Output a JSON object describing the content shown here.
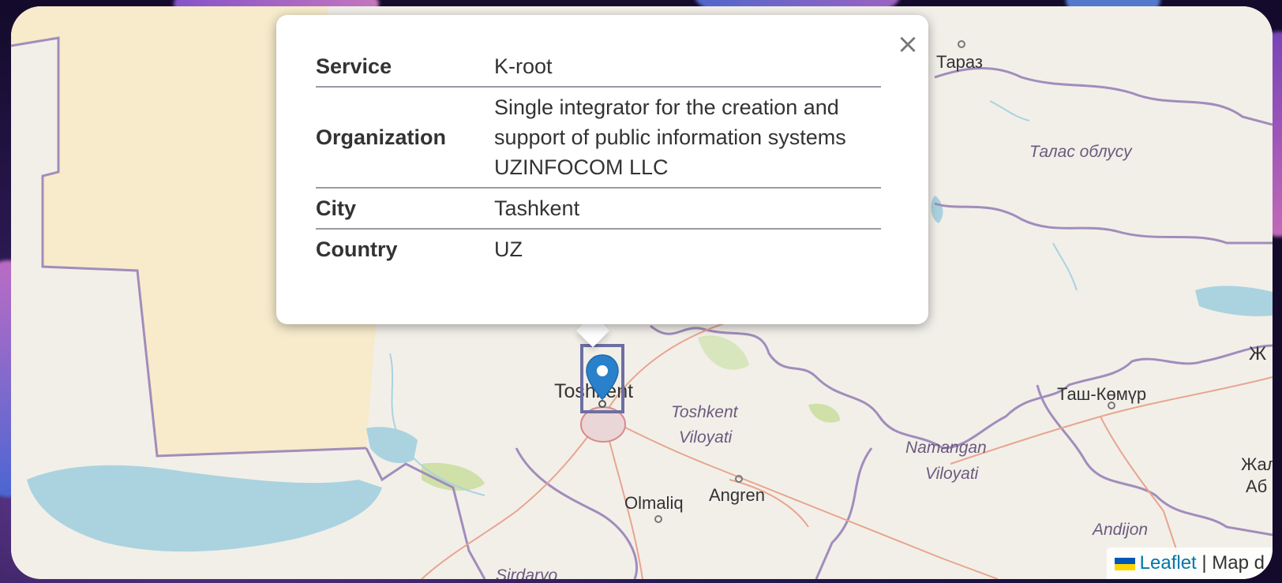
{
  "popup": {
    "rows": [
      {
        "key": "Service",
        "value": "K-root"
      },
      {
        "key": "Organization",
        "value": "Single integrator for the creation and support of public information systems UZINFOCOM LLC"
      },
      {
        "key": "City",
        "value": "Tashkent"
      },
      {
        "key": "Country",
        "value": "UZ"
      }
    ],
    "close_glyph": "×"
  },
  "map_labels": {
    "taraz": "Тараз",
    "talas": "Талас облусу",
    "toshkent": "Toshkent",
    "toshkent_viloyati_1": "Toshkent",
    "toshkent_viloyati_2": "Viloyati",
    "tash_komur": "Таш-Көмүр",
    "namangan_1": "Namangan",
    "namangan_2": "Viloyati",
    "olmaliq": "Olmaliq",
    "angren": "Angren",
    "sirdaryo": "Sirdaryo",
    "andijon": "Andijon",
    "zh": "Ж",
    "zhal": "Жал",
    "ab": "Аб"
  },
  "attribution": {
    "leaflet": "Leaflet",
    "separator": "|",
    "map_text": "Map d"
  },
  "icons": {
    "marker": "map-marker-icon",
    "close": "close-icon",
    "flag": "ukraine-flag-icon"
  },
  "colors": {
    "marker_blue": "#2a81cb",
    "land": "#f2efe9",
    "kazakh_fill": "#f7ebcb",
    "water": "#aad3df",
    "border": "#9e86b3"
  }
}
